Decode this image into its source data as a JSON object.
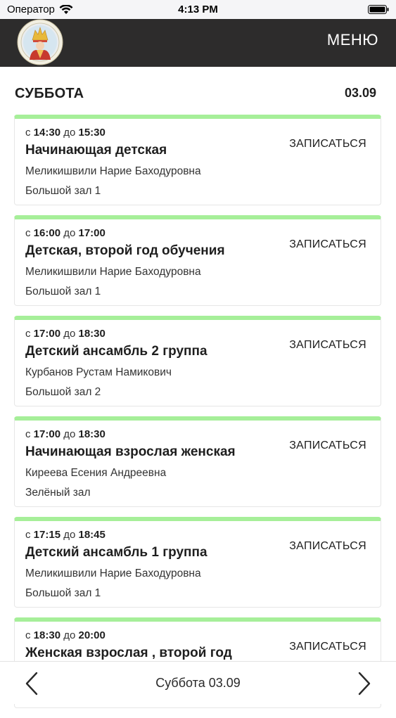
{
  "status_bar": {
    "carrier": "Оператор",
    "time": "4:13 PM"
  },
  "header": {
    "menu_label": "МЕНЮ"
  },
  "day": {
    "title": "СУББОТА",
    "date": "03.09"
  },
  "lessons": [
    {
      "from_prefix": "с",
      "start": "14:30",
      "to_prefix": "до",
      "end": "15:30",
      "title": "Начинающая детская",
      "teacher": "Меликишвили Нарие Баходуровна",
      "room": "Большой зал 1",
      "action": "ЗАПИСАТЬСЯ"
    },
    {
      "from_prefix": "с",
      "start": "16:00",
      "to_prefix": "до",
      "end": "17:00",
      "title": "Детская, второй год обучения",
      "teacher": "Меликишвили Нарие Баходуровна",
      "room": "Большой зал 1",
      "action": "ЗАПИСАТЬСЯ"
    },
    {
      "from_prefix": "с",
      "start": "17:00",
      "to_prefix": "до",
      "end": "18:30",
      "title": "Детский ансамбль 2 группа",
      "teacher": "Курбанов Рустам Намикович",
      "room": "Большой зал 2",
      "action": "ЗАПИСАТЬСЯ"
    },
    {
      "from_prefix": "с",
      "start": "17:00",
      "to_prefix": "до",
      "end": "18:30",
      "title": "Начинающая взрослая женская",
      "teacher": "Киреева Есения Андреевна",
      "room": "Зелёный зал",
      "action": "ЗАПИСАТЬСЯ"
    },
    {
      "from_prefix": "с",
      "start": "17:15",
      "to_prefix": "до",
      "end": "18:45",
      "title": "Детский ансамбль 1 группа",
      "teacher": "Меликишвили Нарие Баходуровна",
      "room": "Большой зал 1",
      "action": "ЗАПИСАТЬСЯ"
    },
    {
      "from_prefix": "с",
      "start": "18:30",
      "to_prefix": "до",
      "end": "20:00",
      "title": "Женская взрослая , второй год",
      "teacher": "",
      "room": "",
      "action": "ЗАПИСАТЬСЯ"
    }
  ],
  "bottom_nav": {
    "label": "Суббота 03.09"
  },
  "colors": {
    "header_bg": "#2d2c2c",
    "card_accent": "#a6ef99",
    "text": "#1e1e1e"
  }
}
